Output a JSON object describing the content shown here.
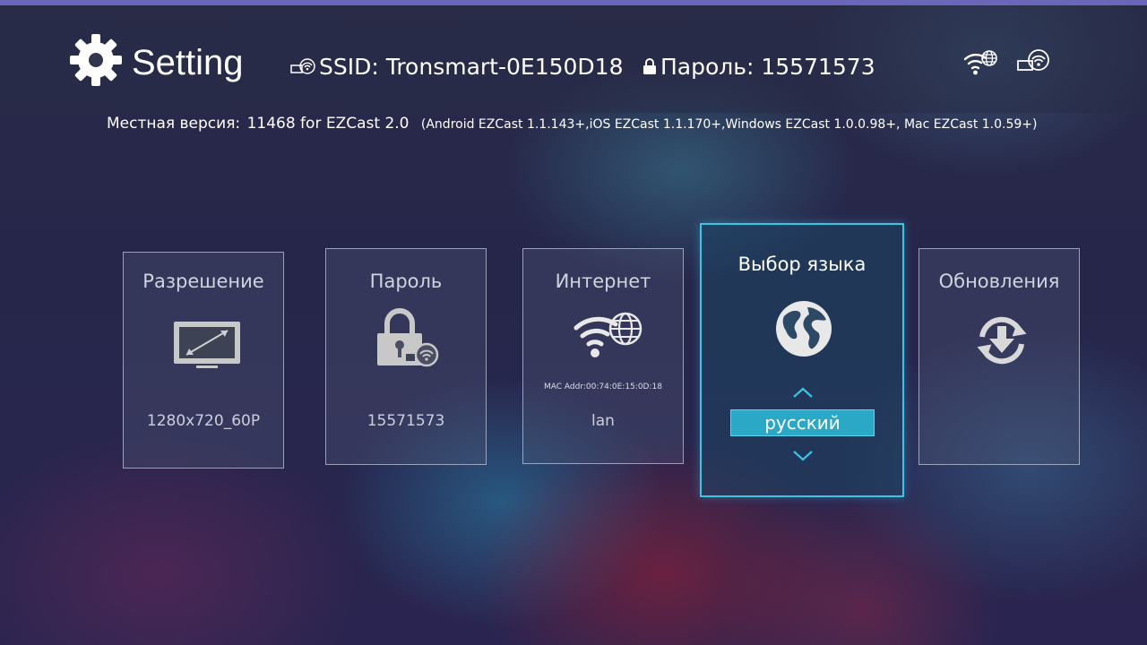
{
  "header": {
    "title": "Setting",
    "ssid": "SSID: Tronsmart-0E150D18",
    "password": "Пароль: 15571573",
    "version_label": "Местная версия:",
    "version_build": "11468  for EZCast 2.0",
    "version_compat": "(Android EZCast 1.1.143+,iOS EZCast 1.1.170+,Windows EZCast 1.0.0.98+, Mac EZCast 1.0.59+)"
  },
  "cards": {
    "resolution": {
      "title": "Разрешение",
      "value": "1280x720_60P",
      "icon": "monitor-resize-icon"
    },
    "password": {
      "title": "Пароль",
      "value": "15571573",
      "icon": "lock-icon"
    },
    "internet": {
      "title": "Интернет",
      "mac": "MAC Addr:00:74:0E:15:0D:18",
      "value": "lan",
      "icon": "wifi-globe-icon"
    },
    "language": {
      "title": "Выбор языка",
      "selected": "русский",
      "icon": "globe-icon"
    },
    "update": {
      "title": "Обновления",
      "icon": "update-icon"
    }
  },
  "colors": {
    "accent": "#36c6e6",
    "selected_bg": "#2aa8c6",
    "top_strip": "#6a66b8"
  }
}
